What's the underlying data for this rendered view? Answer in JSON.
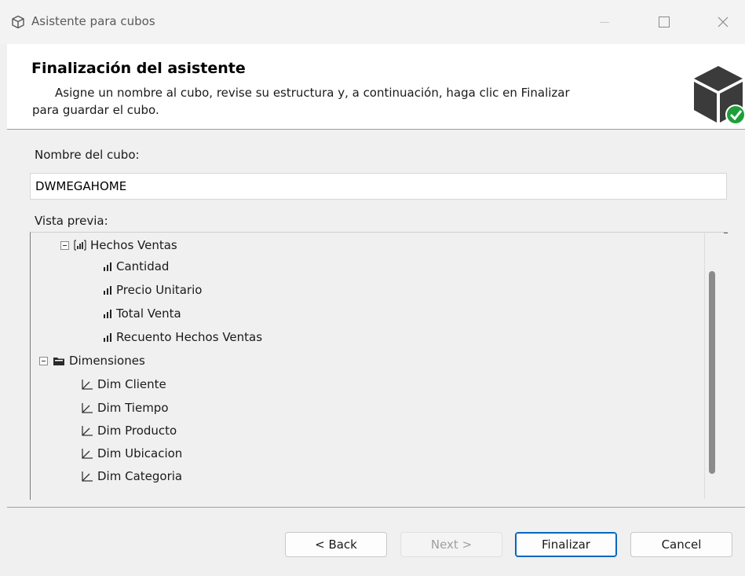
{
  "window": {
    "title": "Asistente para cubos",
    "title_icon": "cube-outline-icon"
  },
  "header": {
    "title": "Finalización del asistente",
    "description_line1": "Asigne un nombre al cubo, revise su estructura y, a continuación, haga clic en Finalizar",
    "description_line2": "para guardar el cubo.",
    "logo_icon": "cube-check-icon"
  },
  "form": {
    "cube_name_label": "Nombre del cubo:",
    "cube_name_value": "DWMEGAHOME",
    "preview_label": "Vista previa:"
  },
  "tree": {
    "measure_group": {
      "label": "Hechos Ventas",
      "icon": "measure-group-icon",
      "measures": [
        {
          "label": "Cantidad",
          "icon": "measure-icon"
        },
        {
          "label": "Precio Unitario",
          "icon": "measure-icon"
        },
        {
          "label": "Total Venta",
          "icon": "measure-icon"
        },
        {
          "label": "Recuento Hechos Ventas",
          "icon": "measure-icon"
        }
      ]
    },
    "dimensions_folder": {
      "label": "Dimensiones",
      "icon": "folder-icon",
      "items": [
        {
          "label": "Dim Cliente",
          "icon": "dimension-icon"
        },
        {
          "label": "Dim Tiempo",
          "icon": "dimension-icon"
        },
        {
          "label": "Dim Producto",
          "icon": "dimension-icon"
        },
        {
          "label": "Dim Ubicacion",
          "icon": "dimension-icon"
        },
        {
          "label": "Dim Categoria",
          "icon": "dimension-icon"
        }
      ]
    }
  },
  "buttons": {
    "back": "< Back",
    "next": "Next >",
    "finish": "Finalizar",
    "cancel": "Cancel"
  },
  "colors": {
    "accent": "#0067c0",
    "check_green": "#1e9e3a"
  }
}
